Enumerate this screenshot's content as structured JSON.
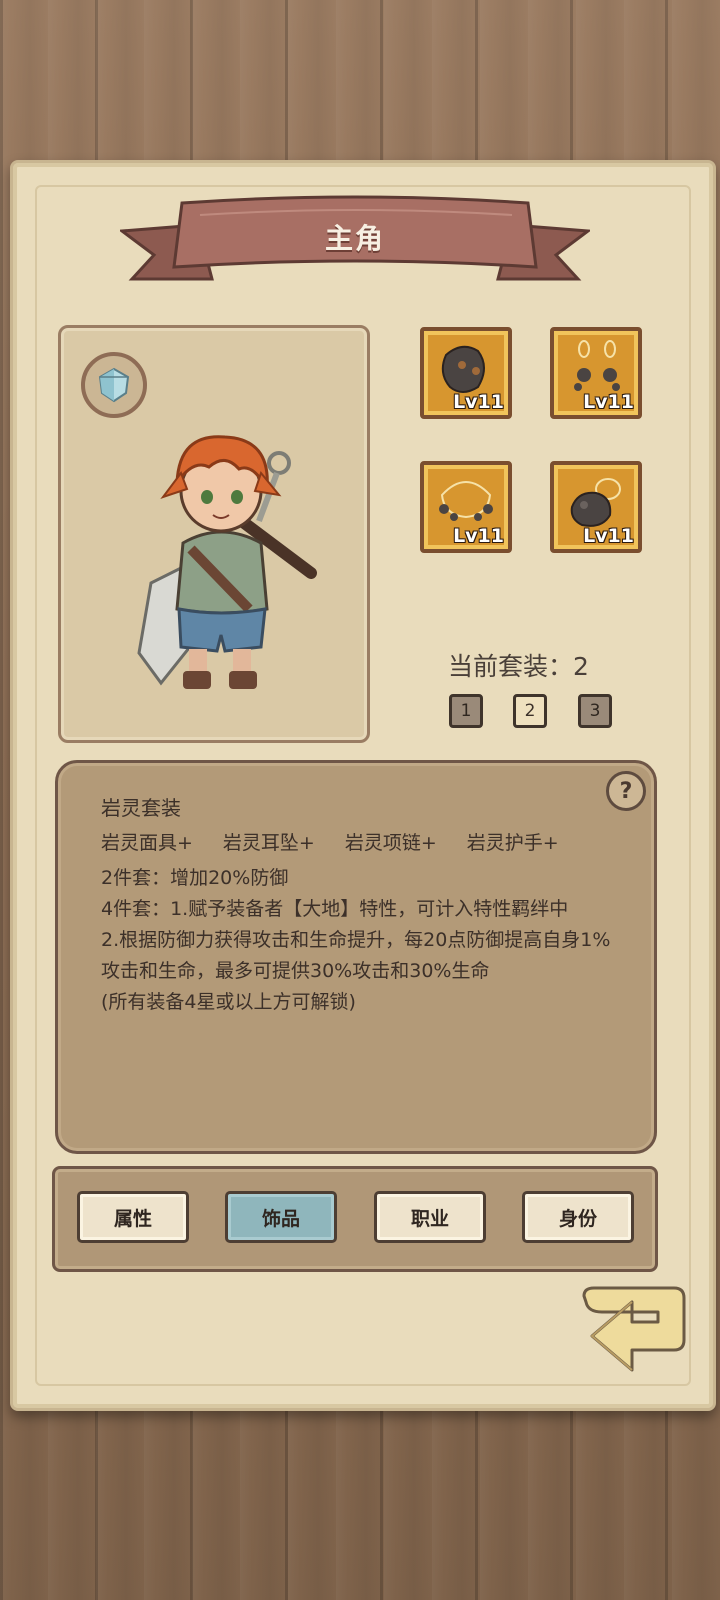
{
  "title": "主角",
  "equipment": [
    {
      "name": "岩灵面具+",
      "level": "Lv11",
      "icon": "rock-mask-icon"
    },
    {
      "name": "岩灵耳坠+",
      "level": "Lv11",
      "icon": "rock-earring-icon"
    },
    {
      "name": "岩灵项链+",
      "level": "Lv11",
      "icon": "rock-necklace-icon"
    },
    {
      "name": "岩灵护手+",
      "level": "Lv11",
      "icon": "rock-gauntlet-icon"
    }
  ],
  "current_set": {
    "label": "当前套装：2",
    "buttons": [
      "1",
      "2",
      "3"
    ],
    "selected": "2"
  },
  "set_description": {
    "title": "岩灵套装",
    "pieces": [
      "岩灵面具+",
      "岩灵耳坠+",
      "岩灵项链+",
      "岩灵护手+"
    ],
    "lines": [
      "2件套：增加20%防御",
      "4件套：1.赋予装备者【大地】特性，可计入特性羁绊中",
      "2.根据防御力获得攻击和生命提升，每20点防御提高自身1%攻击和生命，最多可提供30%攻击和30%生命",
      "(所有装备4星或以上方可解锁)"
    ],
    "help": "?"
  },
  "tabs": [
    {
      "label": "属性",
      "active": false
    },
    {
      "label": "饰品",
      "active": true
    },
    {
      "label": "职业",
      "active": false
    },
    {
      "label": "身份",
      "active": false
    }
  ],
  "colors": {
    "ribbon": "#a86f64",
    "slot_frame": "#d7962f",
    "active_tab": "#8fb6bc",
    "parchment": "#e9dcbc"
  }
}
